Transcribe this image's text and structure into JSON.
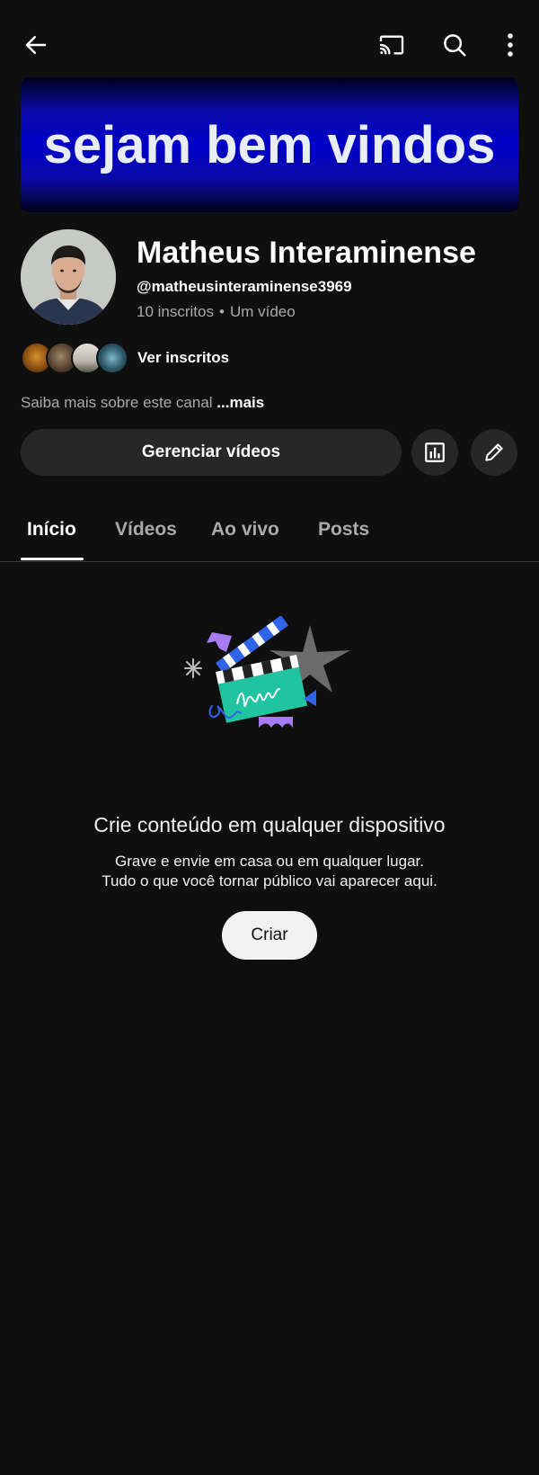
{
  "topbar": {
    "back_icon": "arrow-left-icon",
    "cast_icon": "cast-icon",
    "search_icon": "search-icon",
    "more_icon": "more-vertical-icon"
  },
  "banner": {
    "text": "sejam bem vindos"
  },
  "channel": {
    "name": "Matheus Interaminense",
    "handle": "@matheusinteraminense3969",
    "subscribers": "10 inscritos",
    "separator": "•",
    "videos": "Um vídeo"
  },
  "subscribers_row": {
    "label": "Ver inscritos"
  },
  "about": {
    "text": "Saiba mais sobre este canal ",
    "more": "...mais"
  },
  "actions": {
    "manage_label": "Gerenciar vídeos",
    "stats_icon": "analytics-icon",
    "edit_icon": "pencil-icon"
  },
  "tabs": [
    {
      "label": "Início",
      "active": true
    },
    {
      "label": "Vídeos",
      "active": false
    },
    {
      "label": "Ao vivo",
      "active": false
    },
    {
      "label": "Posts",
      "active": false
    }
  ],
  "empty_state": {
    "title": "Crie conteúdo em qualquer dispositivo",
    "line1": "Grave e envie em casa ou em qualquer lugar.",
    "line2": "Tudo o que você tornar público vai aparecer aqui.",
    "create_label": "Criar"
  },
  "colors": {
    "background": "#0f0f0f",
    "surface": "#272727",
    "text_primary": "#ffffff",
    "text_secondary": "#aaaaaa"
  }
}
